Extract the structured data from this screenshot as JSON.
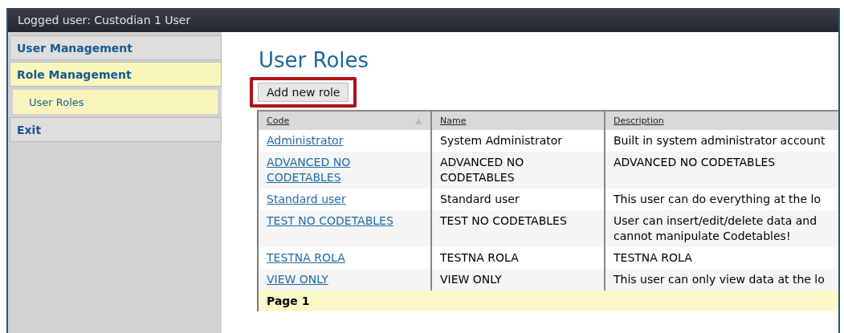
{
  "header": {
    "logged_user": "Logged user: Custodian 1 User"
  },
  "sidebar": {
    "items": [
      {
        "label": "User Management",
        "selected": false
      },
      {
        "label": "Role Management",
        "selected": true,
        "children": [
          {
            "label": "User Roles",
            "selected": true
          }
        ]
      },
      {
        "label": "Exit",
        "selected": false
      }
    ]
  },
  "page": {
    "title": "User Roles",
    "add_button": "Add new role"
  },
  "table": {
    "columns": [
      {
        "label": "Code",
        "sorted": true
      },
      {
        "label": "Name"
      },
      {
        "label": "Description"
      }
    ],
    "rows": [
      {
        "code": "Administrator",
        "name": "System Administrator",
        "description": "Built in system administrator account"
      },
      {
        "code": "ADVANCED NO\nCODETABLES",
        "name": "ADVANCED NO\nCODETABLES",
        "description": "ADVANCED NO CODETABLES"
      },
      {
        "code": "Standard user",
        "name": "Standard user",
        "description": "This user can do everything at the lo"
      },
      {
        "code": "TEST NO CODETABLES",
        "name": "TEST NO CODETABLES",
        "description": "User can insert/edit/delete data and\ncannot manipulate Codetables!"
      },
      {
        "code": "TESTNA ROLA",
        "name": "TESTNA ROLA",
        "description": "TESTNA ROLA"
      },
      {
        "code": "VIEW ONLY",
        "name": "VIEW ONLY",
        "description": "This user can only view data at the lo"
      }
    ],
    "pager": "Page 1"
  }
}
